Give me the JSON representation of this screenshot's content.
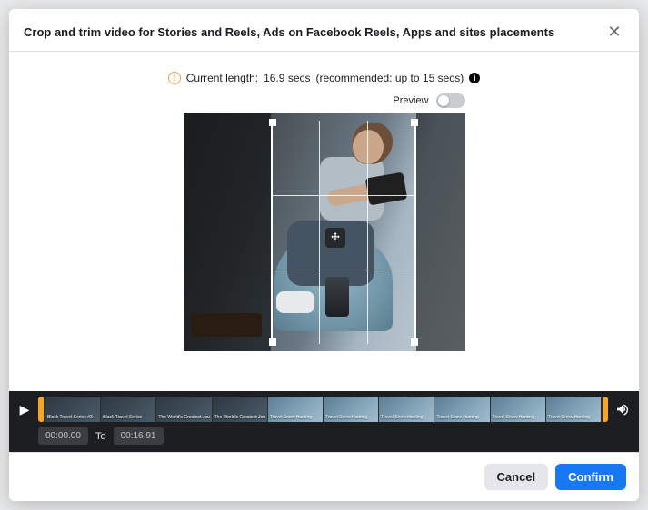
{
  "header": {
    "title": "Crop and trim video for Stories and Reels, Ads on Facebook Reels, Apps and sites placements"
  },
  "length_row": {
    "prefix": "Current length:",
    "value": "16.9 secs",
    "recommended": "(recommended: up to 15 secs)"
  },
  "preview": {
    "label": "Preview",
    "on": false
  },
  "timeline": {
    "from": "00:00.00",
    "to_label": "To",
    "to": "00:16.91",
    "thumbs": [
      {
        "caption": "Black Travel Series #3"
      },
      {
        "caption": "Black Travel Series"
      },
      {
        "caption": "The World's Greatest Journey"
      },
      {
        "caption": "The World's Greatest Journey"
      },
      {
        "caption": "Travel Snow Hunting"
      },
      {
        "caption": "Travel Snow Hunting"
      },
      {
        "caption": "Travel Snow Hunting"
      },
      {
        "caption": "Travel Snow Hunting"
      },
      {
        "caption": "Travel Snow Hunting"
      },
      {
        "caption": "Travel Snow Hunting"
      }
    ]
  },
  "footer": {
    "cancel": "Cancel",
    "confirm": "Confirm"
  }
}
